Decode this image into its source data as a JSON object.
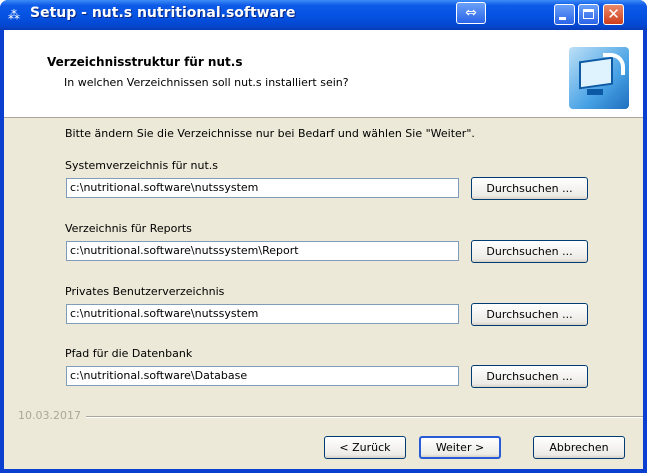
{
  "window": {
    "title": "Setup - nut.s nutritional.software",
    "extra_button_symbol": "⇔",
    "close_symbol": "✕"
  },
  "header": {
    "title": "Verzeichnisstruktur für nut.s",
    "subtitle": "In welchen Verzeichnissen soll nut.s installiert sein?"
  },
  "body": {
    "instruction": "Bitte ändern Sie die Verzeichnisse nur bei Bedarf und wählen Sie \"Weiter\".",
    "fields": [
      {
        "label": "Systemverzeichnis für nut.s",
        "value": "c:\\nutritional.software\\nutssystem",
        "button": "Durchsuchen ..."
      },
      {
        "label": "Verzeichnis für Reports",
        "value": "c:\\nutritional.software\\nutssystem\\Report",
        "button": "Durchsuchen ..."
      },
      {
        "label": "Privates Benutzerverzeichnis",
        "value": "c:\\nutritional.software\\nutssystem",
        "button": "Durchsuchen ..."
      },
      {
        "label": "Pfad für die Datenbank",
        "value": "c:\\nutritional.software\\Database",
        "button": "Durchsuchen ..."
      }
    ]
  },
  "footer": {
    "version": "10.03.2017",
    "back_label": "< Zurück",
    "next_label": "Weiter >",
    "cancel_label": "Abbrechen"
  }
}
